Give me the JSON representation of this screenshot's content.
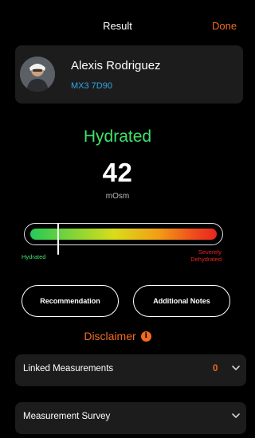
{
  "header": {
    "title": "Result",
    "done_label": "Done"
  },
  "profile": {
    "name": "Alexis Rodriguez",
    "device": "MX3 7D90"
  },
  "result": {
    "status": "Hydrated",
    "value": "42",
    "unit": "mOsm",
    "gauge_level": 0.15,
    "gauge_left_label": "Hydrated",
    "gauge_right_label_line1": "Severely",
    "gauge_right_label_line2": "Dehydrated"
  },
  "actions": {
    "recommendation_label": "Recommendation",
    "notes_label": "Additional Notes"
  },
  "disclaimer": {
    "label": "Disclaimer"
  },
  "linked": {
    "label": "Linked Measurements",
    "count": "0"
  },
  "survey": {
    "label": "Measurement Survey"
  },
  "colors": {
    "accent": "#f26b1f",
    "hydrated": "#3ee26a",
    "link": "#2ea5e8",
    "card": "#1c1c1c"
  },
  "icons": {
    "avatar": "avatar",
    "info": "info-icon",
    "chevron": "chevron-down-icon"
  }
}
